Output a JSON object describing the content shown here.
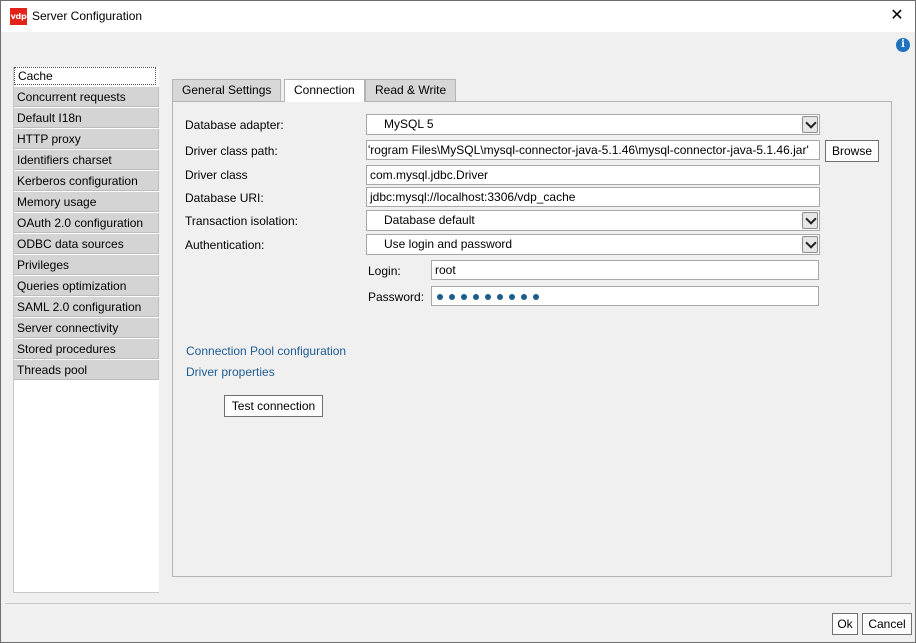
{
  "window": {
    "title": "Server Configuration",
    "app_icon_text": "vdp",
    "close_glyph": "✕",
    "info_glyph": "i"
  },
  "sidebar": {
    "items": [
      {
        "label": "Cache",
        "selected": true
      },
      {
        "label": "Concurrent requests"
      },
      {
        "label": "Default I18n"
      },
      {
        "label": "HTTP proxy"
      },
      {
        "label": "Identifiers charset"
      },
      {
        "label": "Kerberos configuration"
      },
      {
        "label": "Memory usage"
      },
      {
        "label": "OAuth 2.0 configuration"
      },
      {
        "label": "ODBC data sources"
      },
      {
        "label": "Privileges"
      },
      {
        "label": "Queries optimization"
      },
      {
        "label": "SAML 2.0 configuration"
      },
      {
        "label": "Server connectivity"
      },
      {
        "label": "Stored procedures"
      },
      {
        "label": "Threads pool"
      }
    ]
  },
  "tabs": [
    {
      "label": "General Settings",
      "active": false
    },
    {
      "label": "Connection",
      "active": true
    },
    {
      "label": "Read & Write",
      "active": false
    }
  ],
  "connection": {
    "database_adapter_label": "Database adapter:",
    "database_adapter_value": "MySQL 5",
    "driver_class_path_label": "Driver class path:",
    "driver_class_path_value": "'rogram Files\\MySQL\\mysql-connector-java-5.1.46\\mysql-connector-java-5.1.46.jar'",
    "browse_label": "Browse",
    "driver_class_label": "Driver class",
    "driver_class_value": "com.mysql.jdbc.Driver",
    "database_uri_label": "Database URI:",
    "database_uri_value": "jdbc:mysql://localhost:3306/vdp_cache",
    "transaction_isolation_label": "Transaction isolation:",
    "transaction_isolation_value": "Database default",
    "authentication_label": "Authentication:",
    "authentication_value": "Use login and password",
    "login_label": "Login:",
    "login_value": "root",
    "password_label": "Password:",
    "password_length": 9,
    "pool_link": "Connection Pool configuration",
    "driver_props_link": "Driver properties",
    "test_button": "Test connection"
  },
  "footer": {
    "ok_label": "Ok",
    "cancel_label": "Cancel"
  },
  "colors": {
    "link": "#1e5c94",
    "password_dot": "#1b5e8c",
    "app_icon": "#e2231a",
    "info_icon": "#1e73be"
  }
}
